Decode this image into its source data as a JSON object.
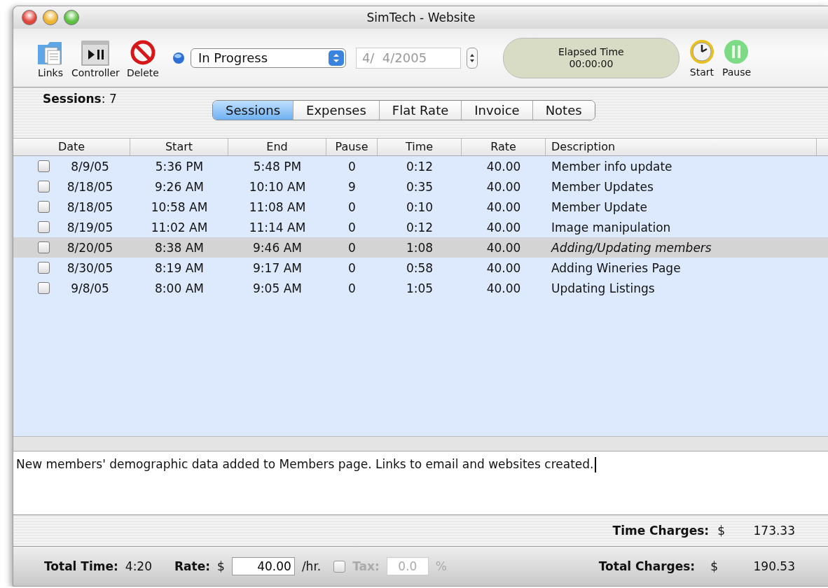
{
  "window": {
    "title": "SimTech - Website"
  },
  "toolbar": {
    "left_buttons": [
      {
        "kind": "links",
        "label": "Links"
      },
      {
        "kind": "controller",
        "label": "Controller"
      },
      {
        "kind": "delete",
        "label": "Delete"
      }
    ],
    "status_select": {
      "value": "In Progress"
    },
    "date_field": {
      "value": "4/  4/2005",
      "disabled": true
    },
    "elapsed": {
      "label": "Elapsed Time",
      "value": "00:00:00"
    },
    "right_buttons": [
      {
        "kind": "start",
        "label": "Start"
      },
      {
        "kind": "pause",
        "label": "Pause"
      }
    ]
  },
  "sessions_count": "**Sessions**: 7",
  "tabs": [
    {
      "label": "Sessions",
      "selected": true
    },
    {
      "label": "Expenses",
      "selected": false
    },
    {
      "label": "Flat Rate",
      "selected": false
    },
    {
      "label": "Invoice",
      "selected": false
    },
    {
      "label": "Notes",
      "selected": false
    }
  ],
  "table": {
    "columns": [
      "Date",
      "Start",
      "End",
      "Pause",
      "Time",
      "Rate",
      "Description"
    ],
    "rows": [
      {
        "checked": false,
        "selected": false,
        "cells": [
          "8/9/05",
          "5:36 PM",
          "5:48 PM",
          "0",
          "0:12",
          "40.00",
          "Member info update"
        ]
      },
      {
        "checked": false,
        "selected": false,
        "cells": [
          "8/18/05",
          "9:26 AM",
          "10:10 AM",
          "9",
          "0:35",
          "40.00",
          "Member Updates"
        ]
      },
      {
        "checked": false,
        "selected": false,
        "cells": [
          "8/18/05",
          "10:58 AM",
          "11:08 AM",
          "0",
          "0:10",
          "40.00",
          "Member Update"
        ]
      },
      {
        "checked": false,
        "selected": false,
        "cells": [
          "8/19/05",
          "11:02 AM",
          "11:14 AM",
          "0",
          "0:12",
          "40.00",
          "Image manipulation"
        ]
      },
      {
        "checked": false,
        "selected": true,
        "cells": [
          "8/20/05",
          "8:38 AM",
          "9:46 AM",
          "0",
          "1:08",
          "40.00",
          "Adding/Updating members"
        ]
      },
      {
        "checked": false,
        "selected": false,
        "cells": [
          "8/30/05",
          "8:19 AM",
          "9:17 AM",
          "0",
          "0:58",
          "40.00",
          "Adding Wineries Page"
        ]
      },
      {
        "checked": false,
        "selected": false,
        "cells": [
          "9/8/05",
          "8:00 AM",
          "9:05 AM",
          "0",
          "1:05",
          "40.00",
          "Updating Listings"
        ]
      }
    ]
  },
  "notes": {
    "value": "New members' demographic data added to Members page. Links to email and websites created."
  },
  "time_charges": {
    "label": "Time Charges:",
    "currency": "$",
    "value": "173.33"
  },
  "footer": {
    "total_time_label": "Total Time:",
    "total_time": "4:20",
    "rate_label": "Rate:",
    "rate_currency": "$",
    "rate": "40.00",
    "rate_unit": "/hr.",
    "tax": {
      "checked": false,
      "disabled": true,
      "label": "Tax:",
      "value": "0.0",
      "unit": "%"
    },
    "total_charges_label": "Total Charges:",
    "total_charges_currency": "$",
    "total_charges": "190.53"
  }
}
